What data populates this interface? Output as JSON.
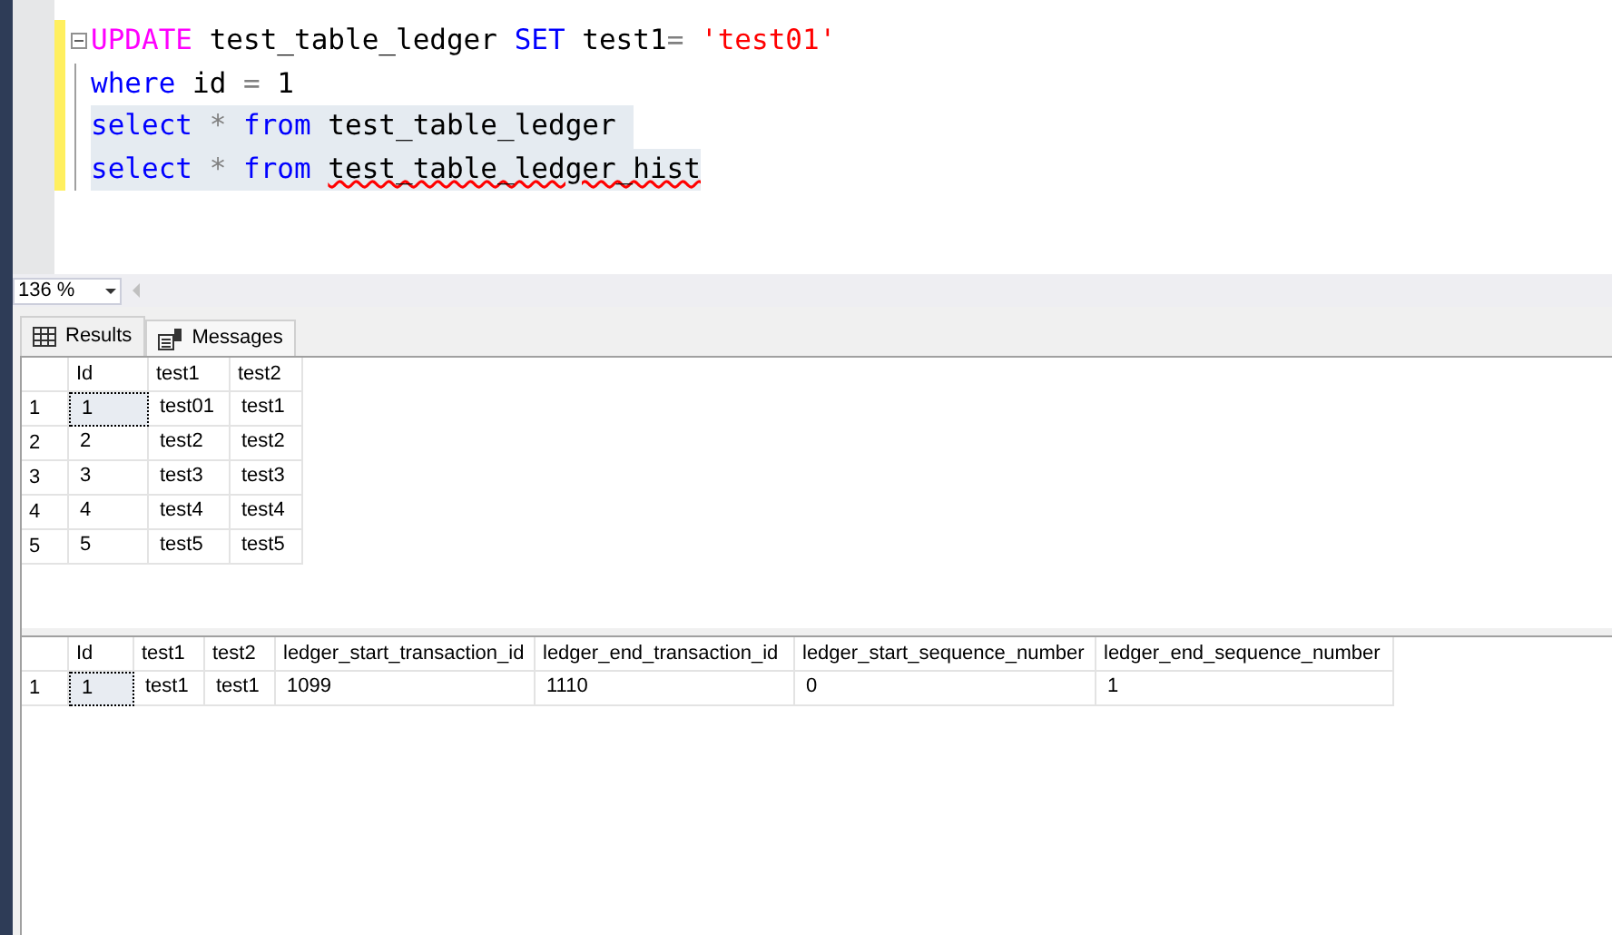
{
  "editor": {
    "lines": [
      {
        "selected": false,
        "folding": true,
        "tokens": [
          {
            "kind": "keyword",
            "text": "UPDATE"
          },
          {
            "kind": "plain",
            "text": " test_table_ledger "
          },
          {
            "kind": "keyword2",
            "text": "SET"
          },
          {
            "kind": "plain",
            "text": " test1"
          },
          {
            "kind": "operator",
            "text": "="
          },
          {
            "kind": "string",
            "text": " 'test01'"
          }
        ]
      },
      {
        "selected": false,
        "folding": false,
        "tokens": [
          {
            "kind": "keyword2",
            "text": "where"
          },
          {
            "kind": "plain",
            "text": " id "
          },
          {
            "kind": "operator",
            "text": "="
          },
          {
            "kind": "plain",
            "text": " 1"
          }
        ]
      },
      {
        "selected": true,
        "folding": false,
        "tokens": [
          {
            "kind": "keyword2",
            "text": "select"
          },
          {
            "kind": "operator",
            "text": " *"
          },
          {
            "kind": "keyword2",
            "text": " from"
          },
          {
            "kind": "plain",
            "text": " test_table_ledger "
          }
        ]
      },
      {
        "selected": true,
        "folding": false,
        "tokens": [
          {
            "kind": "keyword2",
            "text": "select"
          },
          {
            "kind": "operator",
            "text": " *"
          },
          {
            "kind": "keyword2",
            "text": " from "
          },
          {
            "kind": "error",
            "text": "test_table_ledger_hist"
          }
        ]
      }
    ]
  },
  "zoom": {
    "value": "136 %"
  },
  "tabs": [
    {
      "label": "Results",
      "selected": true
    },
    {
      "label": "Messages",
      "selected": false
    }
  ],
  "grids": [
    {
      "columns": [
        "Id",
        "test1",
        "test2"
      ],
      "rows": [
        {
          "number": "1",
          "focused": true,
          "cells": [
            "1",
            "test01",
            "test1"
          ]
        },
        {
          "number": "2",
          "focused": false,
          "cells": [
            "2",
            "test2",
            "test2"
          ]
        },
        {
          "number": "3",
          "focused": false,
          "cells": [
            "3",
            "test3",
            "test3"
          ]
        },
        {
          "number": "4",
          "focused": false,
          "cells": [
            "4",
            "test4",
            "test4"
          ]
        },
        {
          "number": "5",
          "focused": false,
          "cells": [
            "5",
            "test5",
            "test5"
          ]
        }
      ]
    },
    {
      "columns": [
        "Id",
        "test1",
        "test2",
        "ledger_start_transaction_id",
        "ledger_end_transaction_id",
        "ledger_start_sequence_number",
        "ledger_end_sequence_number"
      ],
      "rows": [
        {
          "number": "1",
          "focused": true,
          "cells": [
            "1",
            "test1",
            "test1",
            "1099",
            "1110",
            "0",
            "1"
          ]
        }
      ]
    }
  ]
}
